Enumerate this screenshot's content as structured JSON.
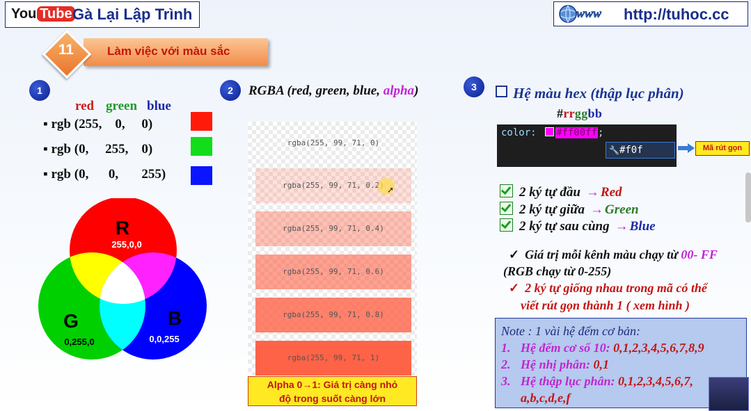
{
  "header": {
    "yt_you": "You",
    "yt_tube": "Tube",
    "channel_name": "Gà Lại Lập Trình",
    "url": "http://tuhoc.cc",
    "www_text": "www"
  },
  "lesson": {
    "number": "11",
    "title": "Làm việc với màu sắc"
  },
  "section1": {
    "number": "1",
    "headers": {
      "red": "red",
      "green": "green",
      "blue": "blue"
    },
    "header_colors": {
      "red": "#d21919",
      "green": "#1f9a2c",
      "blue": "#1b2aa8"
    },
    "rgb_lines": [
      {
        "text": "rgb (255,    0,     0)",
        "color": "#ff1a0a"
      },
      {
        "text": "rgb (0,     255,    0)",
        "color": "#12dd1a"
      },
      {
        "text": "rgb (0,      0,       255)",
        "color": "#0a14ff"
      }
    ],
    "bullet": "▪",
    "venn": {
      "r_label": "R",
      "r_value": "255,0,0",
      "g_label": "G",
      "g_value": "0,255,0",
      "b_label": "B",
      "b_value": "0,0,255"
    }
  },
  "section2": {
    "number": "2",
    "heading_prefix": "RGBA (red, green, blue, ",
    "heading_alpha": "alpha",
    "heading_suffix": ")",
    "rows": [
      {
        "text": "rgba(255, 99, 71, 0)",
        "alpha": 0
      },
      {
        "text": "rgba(255, 99, 71, 0.2)",
        "alpha": 0.2
      },
      {
        "text": "rgba(255, 99, 71, 0.4)",
        "alpha": 0.4
      },
      {
        "text": "rgba(255, 99, 71, 0.6)",
        "alpha": 0.6
      },
      {
        "text": "rgba(255, 99, 71, 0.8)",
        "alpha": 0.8
      },
      {
        "text": "rgba(255, 99, 71, 1)",
        "alpha": 1
      }
    ],
    "note_line1": "Alpha 0→1: Giá trị càng nhỏ",
    "note_line2": "độ trong suốt càng lớn"
  },
  "section3": {
    "number": "3",
    "heading": "Hệ màu hex (thập lục phân)",
    "format": {
      "hash": "#",
      "rr": "rr",
      "gg": "gg",
      "bb": "bb"
    },
    "code": {
      "property": "color:",
      "value": "#ff00ff",
      "semicolon": ";",
      "suggestion": "#f0f"
    },
    "short_label": "Mã rút gọn",
    "checks": [
      {
        "prefix": "2 ký tự đầu",
        "target": "Red",
        "color": "#c41515"
      },
      {
        "prefix": "2 ký tự giữa",
        "target": "Green",
        "color": "#2d7a2d"
      },
      {
        "prefix": "2 ký tự sau cùng",
        "target": "Blue",
        "color": "#1b2aa8"
      }
    ],
    "info1_text": "Giá trị mỗi kênh màu chạy từ ",
    "info1_highlight": "00- FF",
    "info2": "(RGB chạy từ 0-255)",
    "info3_line1": "2 ký tự giống nhau trong mã có thể",
    "info3_line2": "viết rút gọn thành 1 ( xem hình )",
    "note": {
      "title": "Note : 1 vài hệ đếm cơ bản:",
      "items": [
        {
          "num": "1.",
          "label": "Hệ đếm cơ số 10: ",
          "value": "0,1,2,3,4,5,6,7,8,9"
        },
        {
          "num": "2.",
          "label": "Hệ nhị phân: ",
          "value": "0,1"
        },
        {
          "num": "3.",
          "label": "Hệ thập lục phân: ",
          "value": "0,1,2,3,4,5,6,7,"
        }
      ],
      "continuation": "a,b,c,d,e,f"
    }
  }
}
